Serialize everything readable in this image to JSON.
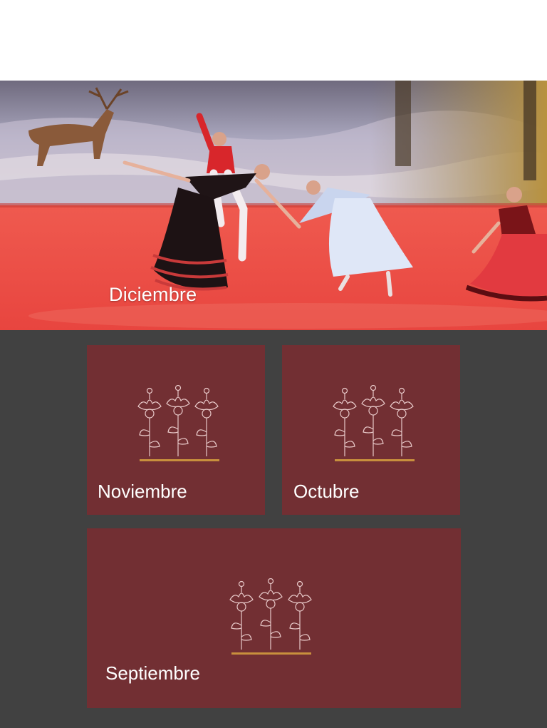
{
  "hero": {
    "label": "Diciembre"
  },
  "tiles": [
    {
      "label": "Noviembre"
    },
    {
      "label": "Octubre"
    },
    {
      "label": "Septiembre"
    }
  ],
  "icons": {
    "tile_icon": "flowers-icon"
  },
  "colors": {
    "tile_background": "#722f33",
    "section_background": "#414141",
    "icon_line": "#e8c9c9",
    "icon_ground": "#c8903d",
    "label_text": "#ffffff"
  }
}
